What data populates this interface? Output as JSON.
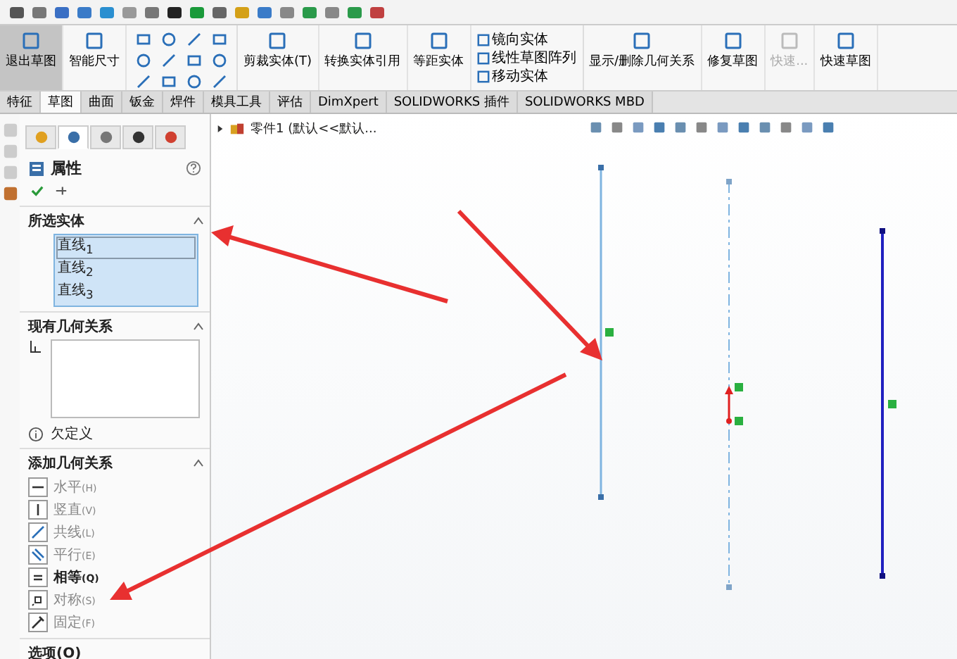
{
  "ribbon": [
    {
      "kind": "large",
      "label": "退出草图",
      "selected": true,
      "disabled": false
    },
    {
      "kind": "large",
      "label": "智能尺寸",
      "selected": false,
      "disabled": false
    },
    {
      "kind": "tools"
    },
    {
      "kind": "large",
      "label": "剪裁实体(T)",
      "selected": false,
      "disabled": false
    },
    {
      "kind": "large",
      "label": "转换实体引用",
      "selected": false,
      "disabled": false
    },
    {
      "kind": "large",
      "label": "等距实体",
      "selected": false,
      "disabled": false
    },
    {
      "kind": "list",
      "items": [
        "镜向实体",
        "线性草图阵列",
        "移动实体"
      ]
    },
    {
      "kind": "large",
      "label": "显示/删除几何关系",
      "selected": false,
      "disabled": false
    },
    {
      "kind": "large",
      "label": "修复草图",
      "selected": false,
      "disabled": false
    },
    {
      "kind": "large",
      "label": "快速...",
      "selected": false,
      "disabled": true
    },
    {
      "kind": "large",
      "label": "快速草图",
      "selected": false,
      "disabled": false
    }
  ],
  "tabs": [
    {
      "label": "特征",
      "selected": false
    },
    {
      "label": "草图",
      "selected": true
    },
    {
      "label": "曲面",
      "selected": false
    },
    {
      "label": "钣金",
      "selected": false
    },
    {
      "label": "焊件",
      "selected": false
    },
    {
      "label": "模具工具",
      "selected": false
    },
    {
      "label": "评估",
      "selected": false
    },
    {
      "label": "DimXpert",
      "selected": false
    },
    {
      "label": "SOLIDWORKS 插件",
      "selected": false
    },
    {
      "label": "SOLIDWORKS MBD",
      "selected": false
    }
  ],
  "panel": {
    "tabs": [
      {
        "selected": false
      },
      {
        "selected": true
      },
      {
        "selected": false
      },
      {
        "selected": false
      },
      {
        "selected": false
      }
    ],
    "title": "属性",
    "selected_entities": {
      "title": "所选实体",
      "items": [
        {
          "label": "直线$_{1}$",
          "selected": true
        },
        {
          "label": "直线$_{2}$",
          "selected": false
        },
        {
          "label": "直线$_{3}$",
          "selected": false
        }
      ]
    },
    "existing_relations": {
      "title": "现有几何关系",
      "status": "欠定义"
    },
    "add_relations": {
      "title": "添加几何关系",
      "items": [
        {
          "label": "水平",
          "key": "(H)",
          "enabled": false
        },
        {
          "label": "竖直",
          "key": "(V)",
          "enabled": false
        },
        {
          "label": "共线",
          "key": "(L)",
          "enabled": false
        },
        {
          "label": "平行",
          "key": "(E)",
          "enabled": false
        },
        {
          "label": "相等",
          "key": "(Q)",
          "enabled": true
        },
        {
          "label": "对称",
          "key": "(S)",
          "enabled": false
        },
        {
          "label": "固定",
          "key": "(F)",
          "enabled": false
        }
      ]
    },
    "options": {
      "title": "选项(O)"
    }
  },
  "canvas": {
    "tree_item": "零件1 (默认<<默认..."
  }
}
